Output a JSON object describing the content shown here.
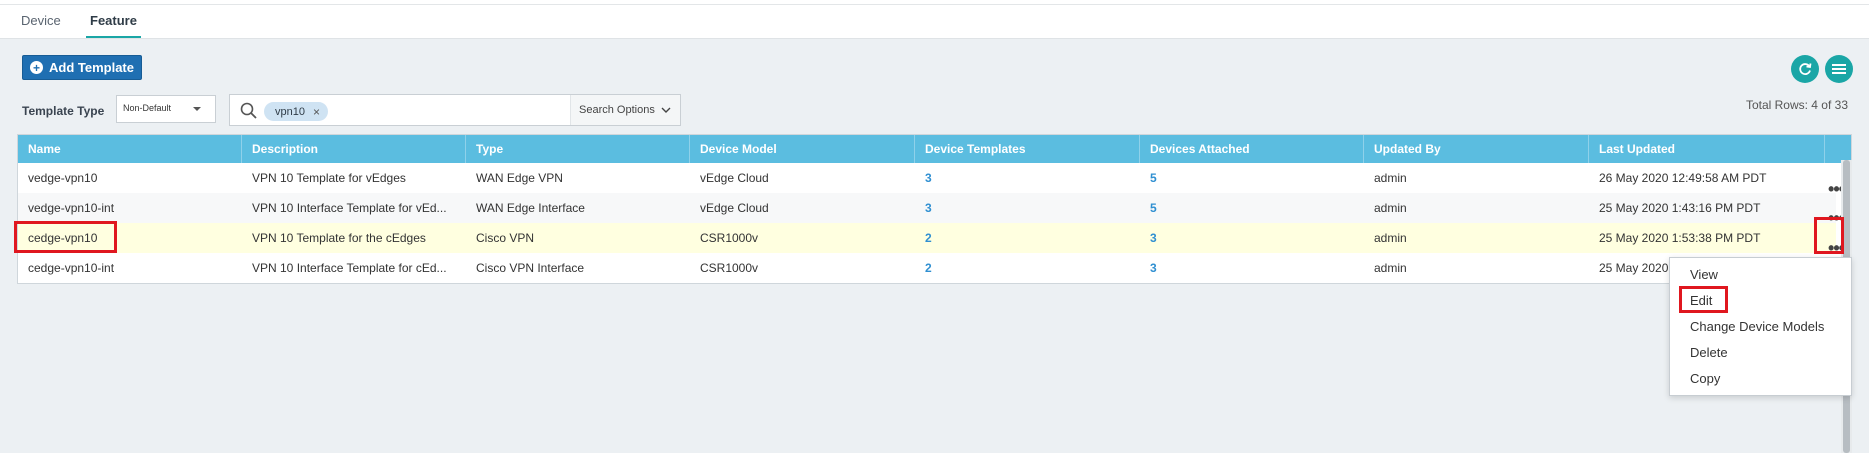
{
  "tabs": [
    {
      "label": "Device"
    },
    {
      "label": "Feature"
    }
  ],
  "toolbar": {
    "add_template_label": "Add Template",
    "refresh_icon": "refresh-icon",
    "menu_icon": "hamburger-menu-icon"
  },
  "filters": {
    "template_type_label": "Template Type",
    "template_type_value": "Non-Default",
    "search_chip": "vpn10",
    "search_options_label": "Search Options"
  },
  "total_rows": "Total Rows: 4 of 33",
  "table": {
    "columns": [
      "Name",
      "Description",
      "Type",
      "Device Model",
      "Device Templates",
      "Devices Attached",
      "Updated By",
      "Last Updated"
    ],
    "rows": [
      {
        "name": "vedge-vpn10",
        "description": "VPN 10 Template for vEdges",
        "type": "WAN Edge VPN",
        "device_model": "vEdge Cloud",
        "device_templates": "3",
        "devices_attached": "5",
        "updated_by": "admin",
        "last_updated": "26 May 2020 12:49:58 AM PDT"
      },
      {
        "name": "vedge-vpn10-int",
        "description": "VPN 10 Interface Template for vEd...",
        "type": "WAN Edge Interface",
        "device_model": "vEdge Cloud",
        "device_templates": "3",
        "devices_attached": "5",
        "updated_by": "admin",
        "last_updated": "25 May 2020 1:43:16 PM PDT"
      },
      {
        "name": "cedge-vpn10",
        "description": "VPN 10 Template for the cEdges",
        "type": "Cisco VPN",
        "device_model": "CSR1000v",
        "device_templates": "2",
        "devices_attached": "3",
        "updated_by": "admin",
        "last_updated": "25 May 2020 1:53:38 PM PDT"
      },
      {
        "name": "cedge-vpn10-int",
        "description": "VPN 10 Interface Template for cEd...",
        "type": "Cisco VPN Interface",
        "device_model": "CSR1000v",
        "device_templates": "2",
        "devices_attached": "3",
        "updated_by": "admin",
        "last_updated": "25 May 2020"
      }
    ]
  },
  "context_menu": {
    "items": [
      "View",
      "Edit",
      "Change Device Models",
      "Delete",
      "Copy"
    ]
  },
  "colors": {
    "header_bg": "#5bbde0",
    "accent_teal": "#1aa6a6",
    "primary_button": "#1f6fb2",
    "highlight_red": "#e0171f",
    "selected_row": "#ffffe0"
  }
}
